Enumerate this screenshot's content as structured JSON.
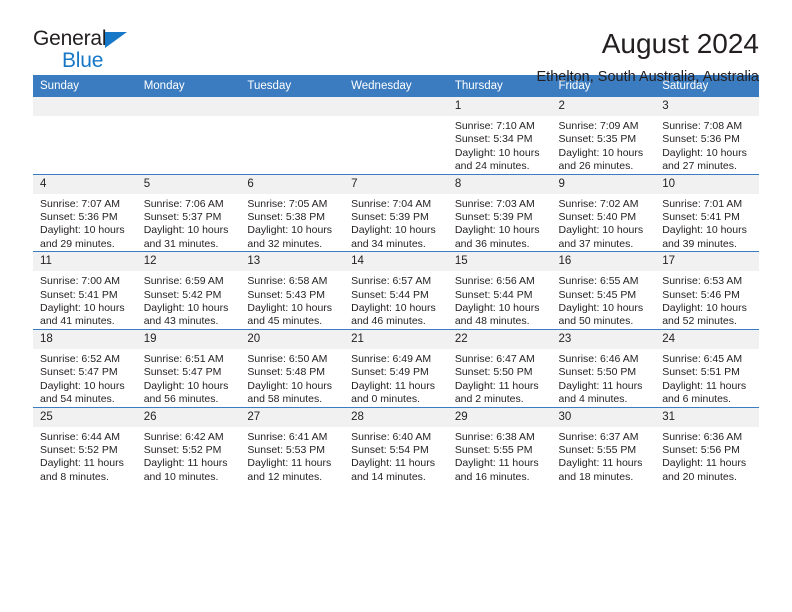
{
  "brand": {
    "name_top": "General",
    "name_bottom": "Blue",
    "accent_color": "#1878c8"
  },
  "header": {
    "title": "August 2024",
    "subtitle": "Ethelton, South Australia, Australia"
  },
  "theme": {
    "header_bar_color": "#3b7cc0",
    "daynum_band_color": "#f1f1f1",
    "text_color": "#231f20"
  },
  "calendar": {
    "weekday_headers": [
      "Sunday",
      "Monday",
      "Tuesday",
      "Wednesday",
      "Thursday",
      "Friday",
      "Saturday"
    ],
    "weeks": [
      [
        {
          "day": "",
          "empty": true,
          "sunrise": "",
          "sunset": "",
          "daylight_line1": "",
          "daylight_line2": ""
        },
        {
          "day": "",
          "empty": true,
          "sunrise": "",
          "sunset": "",
          "daylight_line1": "",
          "daylight_line2": ""
        },
        {
          "day": "",
          "empty": true,
          "sunrise": "",
          "sunset": "",
          "daylight_line1": "",
          "daylight_line2": ""
        },
        {
          "day": "",
          "empty": true,
          "sunrise": "",
          "sunset": "",
          "daylight_line1": "",
          "daylight_line2": ""
        },
        {
          "day": "1",
          "empty": false,
          "sunrise": "Sunrise: 7:10 AM",
          "sunset": "Sunset: 5:34 PM",
          "daylight_line1": "Daylight: 10 hours",
          "daylight_line2": "and 24 minutes."
        },
        {
          "day": "2",
          "empty": false,
          "sunrise": "Sunrise: 7:09 AM",
          "sunset": "Sunset: 5:35 PM",
          "daylight_line1": "Daylight: 10 hours",
          "daylight_line2": "and 26 minutes."
        },
        {
          "day": "3",
          "empty": false,
          "sunrise": "Sunrise: 7:08 AM",
          "sunset": "Sunset: 5:36 PM",
          "daylight_line1": "Daylight: 10 hours",
          "daylight_line2": "and 27 minutes."
        }
      ],
      [
        {
          "day": "4",
          "empty": false,
          "sunrise": "Sunrise: 7:07 AM",
          "sunset": "Sunset: 5:36 PM",
          "daylight_line1": "Daylight: 10 hours",
          "daylight_line2": "and 29 minutes."
        },
        {
          "day": "5",
          "empty": false,
          "sunrise": "Sunrise: 7:06 AM",
          "sunset": "Sunset: 5:37 PM",
          "daylight_line1": "Daylight: 10 hours",
          "daylight_line2": "and 31 minutes."
        },
        {
          "day": "6",
          "empty": false,
          "sunrise": "Sunrise: 7:05 AM",
          "sunset": "Sunset: 5:38 PM",
          "daylight_line1": "Daylight: 10 hours",
          "daylight_line2": "and 32 minutes."
        },
        {
          "day": "7",
          "empty": false,
          "sunrise": "Sunrise: 7:04 AM",
          "sunset": "Sunset: 5:39 PM",
          "daylight_line1": "Daylight: 10 hours",
          "daylight_line2": "and 34 minutes."
        },
        {
          "day": "8",
          "empty": false,
          "sunrise": "Sunrise: 7:03 AM",
          "sunset": "Sunset: 5:39 PM",
          "daylight_line1": "Daylight: 10 hours",
          "daylight_line2": "and 36 minutes."
        },
        {
          "day": "9",
          "empty": false,
          "sunrise": "Sunrise: 7:02 AM",
          "sunset": "Sunset: 5:40 PM",
          "daylight_line1": "Daylight: 10 hours",
          "daylight_line2": "and 37 minutes."
        },
        {
          "day": "10",
          "empty": false,
          "sunrise": "Sunrise: 7:01 AM",
          "sunset": "Sunset: 5:41 PM",
          "daylight_line1": "Daylight: 10 hours",
          "daylight_line2": "and 39 minutes."
        }
      ],
      [
        {
          "day": "11",
          "empty": false,
          "sunrise": "Sunrise: 7:00 AM",
          "sunset": "Sunset: 5:41 PM",
          "daylight_line1": "Daylight: 10 hours",
          "daylight_line2": "and 41 minutes."
        },
        {
          "day": "12",
          "empty": false,
          "sunrise": "Sunrise: 6:59 AM",
          "sunset": "Sunset: 5:42 PM",
          "daylight_line1": "Daylight: 10 hours",
          "daylight_line2": "and 43 minutes."
        },
        {
          "day": "13",
          "empty": false,
          "sunrise": "Sunrise: 6:58 AM",
          "sunset": "Sunset: 5:43 PM",
          "daylight_line1": "Daylight: 10 hours",
          "daylight_line2": "and 45 minutes."
        },
        {
          "day": "14",
          "empty": false,
          "sunrise": "Sunrise: 6:57 AM",
          "sunset": "Sunset: 5:44 PM",
          "daylight_line1": "Daylight: 10 hours",
          "daylight_line2": "and 46 minutes."
        },
        {
          "day": "15",
          "empty": false,
          "sunrise": "Sunrise: 6:56 AM",
          "sunset": "Sunset: 5:44 PM",
          "daylight_line1": "Daylight: 10 hours",
          "daylight_line2": "and 48 minutes."
        },
        {
          "day": "16",
          "empty": false,
          "sunrise": "Sunrise: 6:55 AM",
          "sunset": "Sunset: 5:45 PM",
          "daylight_line1": "Daylight: 10 hours",
          "daylight_line2": "and 50 minutes."
        },
        {
          "day": "17",
          "empty": false,
          "sunrise": "Sunrise: 6:53 AM",
          "sunset": "Sunset: 5:46 PM",
          "daylight_line1": "Daylight: 10 hours",
          "daylight_line2": "and 52 minutes."
        }
      ],
      [
        {
          "day": "18",
          "empty": false,
          "sunrise": "Sunrise: 6:52 AM",
          "sunset": "Sunset: 5:47 PM",
          "daylight_line1": "Daylight: 10 hours",
          "daylight_line2": "and 54 minutes."
        },
        {
          "day": "19",
          "empty": false,
          "sunrise": "Sunrise: 6:51 AM",
          "sunset": "Sunset: 5:47 PM",
          "daylight_line1": "Daylight: 10 hours",
          "daylight_line2": "and 56 minutes."
        },
        {
          "day": "20",
          "empty": false,
          "sunrise": "Sunrise: 6:50 AM",
          "sunset": "Sunset: 5:48 PM",
          "daylight_line1": "Daylight: 10 hours",
          "daylight_line2": "and 58 minutes."
        },
        {
          "day": "21",
          "empty": false,
          "sunrise": "Sunrise: 6:49 AM",
          "sunset": "Sunset: 5:49 PM",
          "daylight_line1": "Daylight: 11 hours",
          "daylight_line2": "and 0 minutes."
        },
        {
          "day": "22",
          "empty": false,
          "sunrise": "Sunrise: 6:47 AM",
          "sunset": "Sunset: 5:50 PM",
          "daylight_line1": "Daylight: 11 hours",
          "daylight_line2": "and 2 minutes."
        },
        {
          "day": "23",
          "empty": false,
          "sunrise": "Sunrise: 6:46 AM",
          "sunset": "Sunset: 5:50 PM",
          "daylight_line1": "Daylight: 11 hours",
          "daylight_line2": "and 4 minutes."
        },
        {
          "day": "24",
          "empty": false,
          "sunrise": "Sunrise: 6:45 AM",
          "sunset": "Sunset: 5:51 PM",
          "daylight_line1": "Daylight: 11 hours",
          "daylight_line2": "and 6 minutes."
        }
      ],
      [
        {
          "day": "25",
          "empty": false,
          "sunrise": "Sunrise: 6:44 AM",
          "sunset": "Sunset: 5:52 PM",
          "daylight_line1": "Daylight: 11 hours",
          "daylight_line2": "and 8 minutes."
        },
        {
          "day": "26",
          "empty": false,
          "sunrise": "Sunrise: 6:42 AM",
          "sunset": "Sunset: 5:52 PM",
          "daylight_line1": "Daylight: 11 hours",
          "daylight_line2": "and 10 minutes."
        },
        {
          "day": "27",
          "empty": false,
          "sunrise": "Sunrise: 6:41 AM",
          "sunset": "Sunset: 5:53 PM",
          "daylight_line1": "Daylight: 11 hours",
          "daylight_line2": "and 12 minutes."
        },
        {
          "day": "28",
          "empty": false,
          "sunrise": "Sunrise: 6:40 AM",
          "sunset": "Sunset: 5:54 PM",
          "daylight_line1": "Daylight: 11 hours",
          "daylight_line2": "and 14 minutes."
        },
        {
          "day": "29",
          "empty": false,
          "sunrise": "Sunrise: 6:38 AM",
          "sunset": "Sunset: 5:55 PM",
          "daylight_line1": "Daylight: 11 hours",
          "daylight_line2": "and 16 minutes."
        },
        {
          "day": "30",
          "empty": false,
          "sunrise": "Sunrise: 6:37 AM",
          "sunset": "Sunset: 5:55 PM",
          "daylight_line1": "Daylight: 11 hours",
          "daylight_line2": "and 18 minutes."
        },
        {
          "day": "31",
          "empty": false,
          "sunrise": "Sunrise: 6:36 AM",
          "sunset": "Sunset: 5:56 PM",
          "daylight_line1": "Daylight: 11 hours",
          "daylight_line2": "and 20 minutes."
        }
      ]
    ]
  }
}
